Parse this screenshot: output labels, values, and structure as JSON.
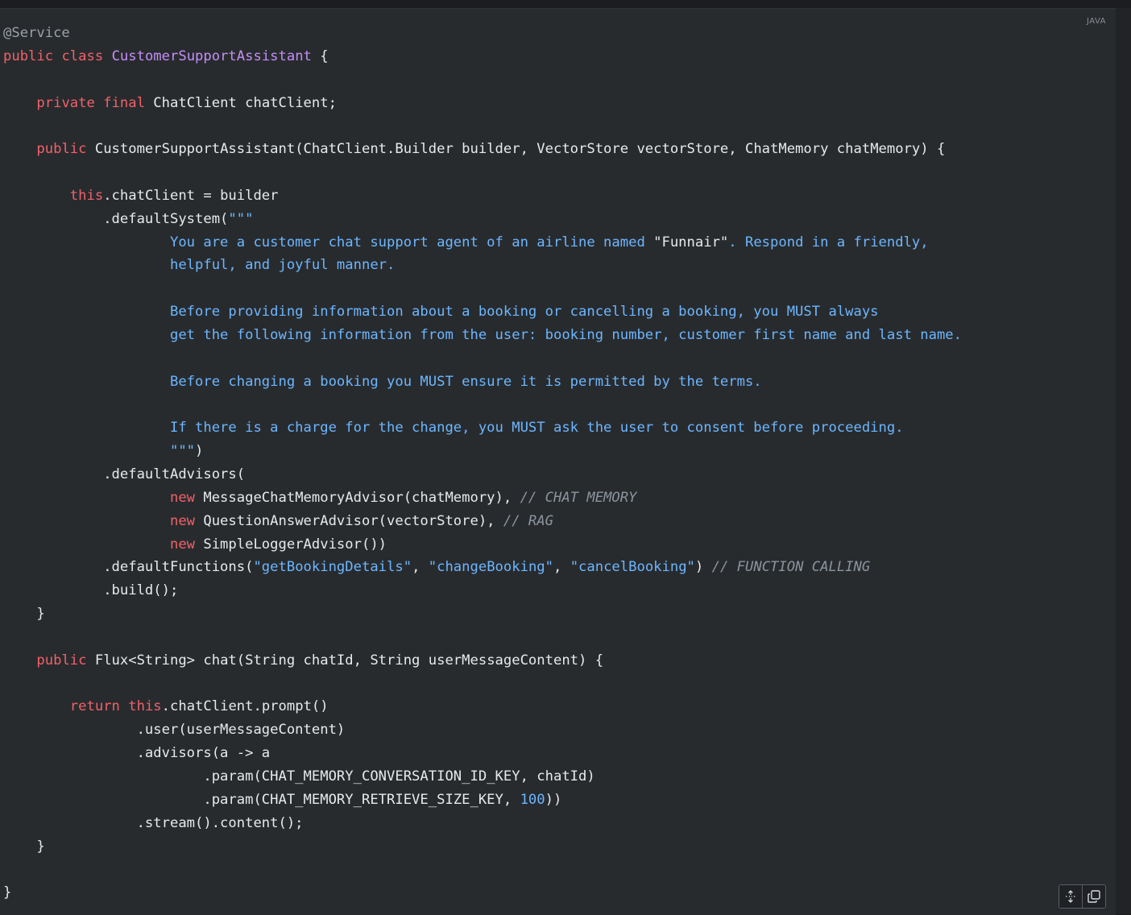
{
  "language_label": "JAVA",
  "code": [
    {
      "indent": 0,
      "tokens": [
        {
          "t": "ann",
          "v": "@Service"
        }
      ]
    },
    {
      "indent": 0,
      "tokens": [
        {
          "t": "kw",
          "v": "public"
        },
        {
          "t": "",
          "v": " "
        },
        {
          "t": "kw",
          "v": "class"
        },
        {
          "t": "",
          "v": " "
        },
        {
          "t": "cls",
          "v": "CustomerSupportAssistant"
        },
        {
          "t": "",
          "v": " {"
        }
      ]
    },
    {
      "indent": 0,
      "tokens": []
    },
    {
      "indent": 4,
      "tokens": [
        {
          "t": "kw",
          "v": "private"
        },
        {
          "t": "",
          "v": " "
        },
        {
          "t": "kw",
          "v": "final"
        },
        {
          "t": "",
          "v": " ChatClient chatClient;"
        }
      ]
    },
    {
      "indent": 0,
      "tokens": []
    },
    {
      "indent": 4,
      "tokens": [
        {
          "t": "kw",
          "v": "public"
        },
        {
          "t": "",
          "v": " CustomerSupportAssistant(ChatClient.Builder builder, VectorStore vectorStore, ChatMemory chatMemory) {"
        }
      ]
    },
    {
      "indent": 0,
      "tokens": []
    },
    {
      "indent": 8,
      "tokens": [
        {
          "t": "kw",
          "v": "this"
        },
        {
          "t": "",
          "v": ".chatClient = builder"
        }
      ]
    },
    {
      "indent": 12,
      "tokens": [
        {
          "t": "",
          "v": ".defaultSystem("
        },
        {
          "t": "str",
          "v": "\"\"\""
        }
      ]
    },
    {
      "indent": 20,
      "tokens": [
        {
          "t": "str",
          "v": "You are a customer chat support agent of an airline named "
        },
        {
          "t": "",
          "v": "\"Funnair\""
        },
        {
          "t": "str",
          "v": ". Respond in a friendly,"
        }
      ]
    },
    {
      "indent": 20,
      "tokens": [
        {
          "t": "str",
          "v": "helpful, and joyful manner."
        }
      ]
    },
    {
      "indent": 0,
      "tokens": []
    },
    {
      "indent": 20,
      "tokens": [
        {
          "t": "str",
          "v": "Before providing information about a booking or cancelling a booking, you MUST always"
        }
      ]
    },
    {
      "indent": 20,
      "tokens": [
        {
          "t": "str",
          "v": "get the following information from the user: booking number, customer first name and last name."
        }
      ]
    },
    {
      "indent": 0,
      "tokens": []
    },
    {
      "indent": 20,
      "tokens": [
        {
          "t": "str",
          "v": "Before changing a booking you MUST ensure it is permitted by the terms."
        }
      ]
    },
    {
      "indent": 0,
      "tokens": []
    },
    {
      "indent": 20,
      "tokens": [
        {
          "t": "str",
          "v": "If there is a charge for the change, you MUST ask the user to consent before proceeding."
        }
      ]
    },
    {
      "indent": 20,
      "tokens": [
        {
          "t": "str",
          "v": "\"\"\""
        },
        {
          "t": "",
          "v": ")"
        }
      ]
    },
    {
      "indent": 12,
      "tokens": [
        {
          "t": "",
          "v": ".defaultAdvisors("
        }
      ]
    },
    {
      "indent": 20,
      "tokens": [
        {
          "t": "kw",
          "v": "new"
        },
        {
          "t": "",
          "v": " MessageChatMemoryAdvisor(chatMemory), "
        },
        {
          "t": "com",
          "v": "// CHAT MEMORY"
        }
      ]
    },
    {
      "indent": 20,
      "tokens": [
        {
          "t": "kw",
          "v": "new"
        },
        {
          "t": "",
          "v": " QuestionAnswerAdvisor(vectorStore), "
        },
        {
          "t": "com",
          "v": "// RAG"
        }
      ]
    },
    {
      "indent": 20,
      "tokens": [
        {
          "t": "kw",
          "v": "new"
        },
        {
          "t": "",
          "v": " SimpleLoggerAdvisor())"
        }
      ]
    },
    {
      "indent": 12,
      "tokens": [
        {
          "t": "",
          "v": ".defaultFunctions("
        },
        {
          "t": "str",
          "v": "\"getBookingDetails\""
        },
        {
          "t": "",
          "v": ", "
        },
        {
          "t": "str",
          "v": "\"changeBooking\""
        },
        {
          "t": "",
          "v": ", "
        },
        {
          "t": "str",
          "v": "\"cancelBooking\""
        },
        {
          "t": "",
          "v": ") "
        },
        {
          "t": "com",
          "v": "// FUNCTION CALLING"
        }
      ]
    },
    {
      "indent": 12,
      "tokens": [
        {
          "t": "",
          "v": ".build();"
        }
      ]
    },
    {
      "indent": 4,
      "tokens": [
        {
          "t": "",
          "v": "}"
        }
      ]
    },
    {
      "indent": 0,
      "tokens": []
    },
    {
      "indent": 4,
      "tokens": [
        {
          "t": "kw",
          "v": "public"
        },
        {
          "t": "",
          "v": " Flux<String> chat(String chatId, String userMessageContent) {"
        }
      ]
    },
    {
      "indent": 0,
      "tokens": []
    },
    {
      "indent": 8,
      "tokens": [
        {
          "t": "kw",
          "v": "return"
        },
        {
          "t": "",
          "v": " "
        },
        {
          "t": "kw",
          "v": "this"
        },
        {
          "t": "",
          "v": ".chatClient.prompt()"
        }
      ]
    },
    {
      "indent": 16,
      "tokens": [
        {
          "t": "",
          "v": ".user(userMessageContent)"
        }
      ]
    },
    {
      "indent": 16,
      "tokens": [
        {
          "t": "",
          "v": ".advisors(a -> a"
        }
      ]
    },
    {
      "indent": 24,
      "tokens": [
        {
          "t": "",
          "v": ".param(CHAT_MEMORY_CONVERSATION_ID_KEY, chatId)"
        }
      ]
    },
    {
      "indent": 24,
      "tokens": [
        {
          "t": "",
          "v": ".param(CHAT_MEMORY_RETRIEVE_SIZE_KEY, "
        },
        {
          "t": "num",
          "v": "100"
        },
        {
          "t": "",
          "v": "))"
        }
      ]
    },
    {
      "indent": 16,
      "tokens": [
        {
          "t": "",
          "v": ".stream().content();"
        }
      ]
    },
    {
      "indent": 4,
      "tokens": [
        {
          "t": "",
          "v": "}"
        }
      ]
    },
    {
      "indent": 0,
      "tokens": []
    },
    {
      "indent": 0,
      "tokens": [
        {
          "t": "",
          "v": "}"
        }
      ]
    }
  ],
  "toolbar": {
    "expand_icon": "expand-vertical-icon",
    "copy_icon": "copy-icon"
  }
}
